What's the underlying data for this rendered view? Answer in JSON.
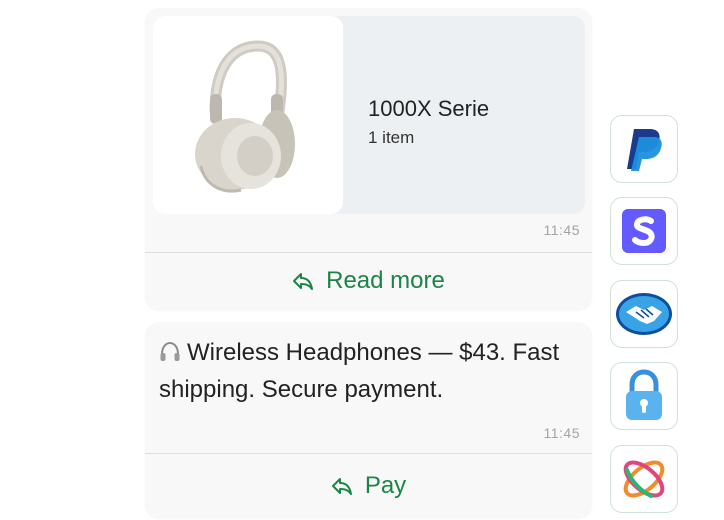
{
  "product": {
    "title": "1000X Serie",
    "subtitle": "1 item",
    "time": "11:45",
    "action_label": "Read more",
    "image_icon": "headphones-image"
  },
  "message": {
    "text": "Wireless Headphones — $43. Fast shipping. Secure payment.",
    "time": "11:45",
    "action_label": "Pay",
    "lead_icon": "headphones-icon"
  },
  "payment_options": [
    {
      "name": "paypal",
      "icon": "paypal-icon"
    },
    {
      "name": "stripe",
      "icon": "stripe-icon"
    },
    {
      "name": "mercadopago",
      "icon": "handshake-icon"
    },
    {
      "name": "lock",
      "icon": "lock-icon"
    },
    {
      "name": "colorful-rings",
      "icon": "rings-icon"
    }
  ],
  "colors": {
    "accent_green": "#1c8446",
    "bubble_bg": "#f8f8f8",
    "card_bg": "#ecf0f2"
  }
}
